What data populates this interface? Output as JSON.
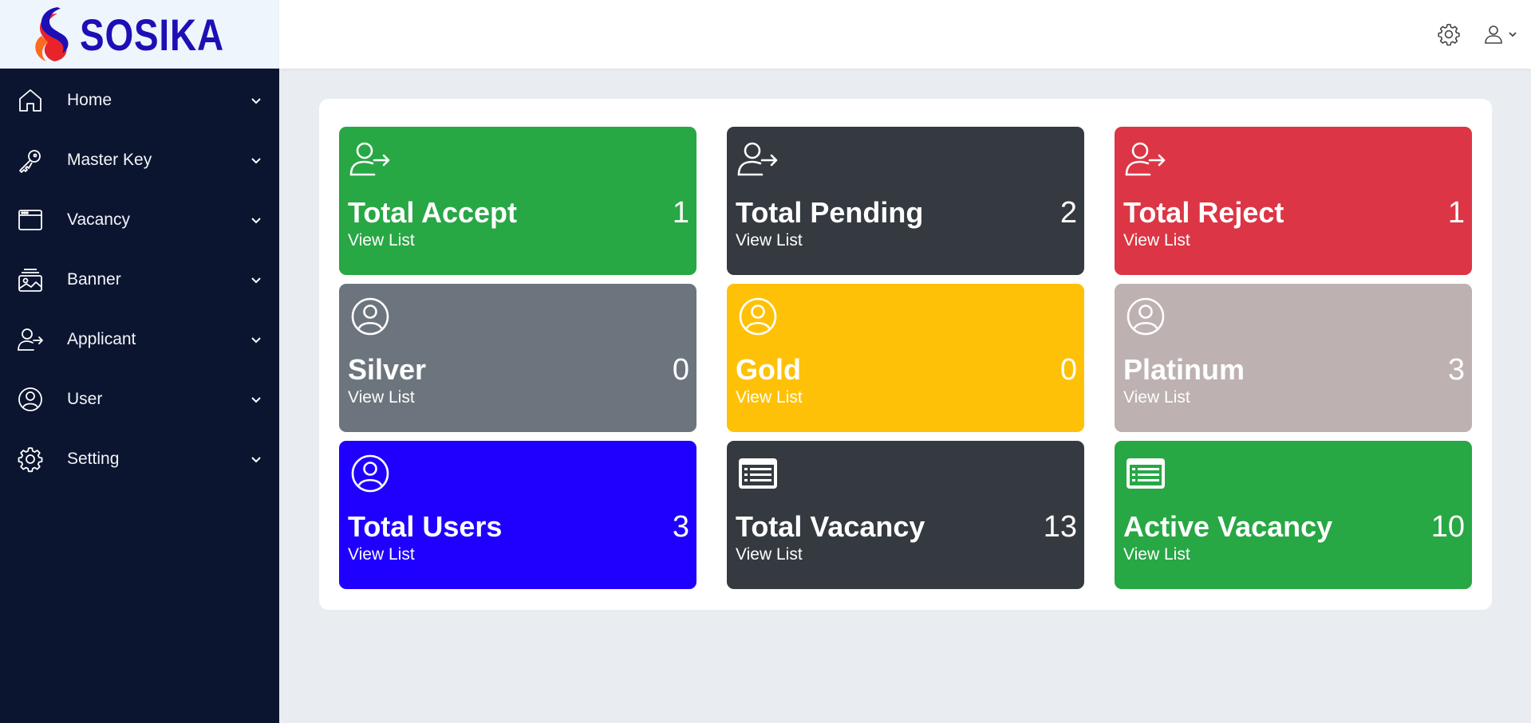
{
  "brand": {
    "name": "SOSIKA"
  },
  "sidebar": {
    "items": [
      {
        "label": "Home",
        "icon": "home-icon"
      },
      {
        "label": "Master Key",
        "icon": "key-icon"
      },
      {
        "label": "Vacancy",
        "icon": "browser-window-icon"
      },
      {
        "label": "Banner",
        "icon": "images-icon"
      },
      {
        "label": "Applicant",
        "icon": "user-arrow-icon"
      },
      {
        "label": "User",
        "icon": "user-circle-icon"
      },
      {
        "label": "Setting",
        "icon": "gear-icon"
      }
    ]
  },
  "topbar": {
    "settings_icon": "gear-icon",
    "user_icon": "user-icon"
  },
  "cards": [
    {
      "title": "Total Accept",
      "count": "1",
      "link": "View List",
      "color": "#28a745",
      "icon": "user-arrow-icon"
    },
    {
      "title": "Total Pending",
      "count": "2",
      "link": "View List",
      "color": "#343a40",
      "icon": "user-arrow-icon"
    },
    {
      "title": "Total Reject",
      "count": "1",
      "link": "View List",
      "color": "#dc3545",
      "icon": "user-arrow-icon"
    },
    {
      "title": "Silver",
      "count": "0",
      "link": "View List",
      "color": "#6c757d",
      "icon": "user-circle-icon"
    },
    {
      "title": "Gold",
      "count": "0",
      "link": "View List",
      "color": "#ffc107",
      "icon": "user-circle-icon"
    },
    {
      "title": "Platinum",
      "count": "3",
      "link": "View List",
      "color": "#bdb1b1",
      "icon": "user-circle-icon"
    },
    {
      "title": "Total Users",
      "count": "3",
      "link": "View List",
      "color": "#1f00ff",
      "icon": "user-circle-icon"
    },
    {
      "title": "Total Vacancy",
      "count": "13",
      "link": "View List",
      "color": "#343a40",
      "icon": "list-card-icon"
    },
    {
      "title": "Active Vacancy",
      "count": "10",
      "link": "View List",
      "color": "#28a745",
      "icon": "list-card-icon"
    }
  ]
}
